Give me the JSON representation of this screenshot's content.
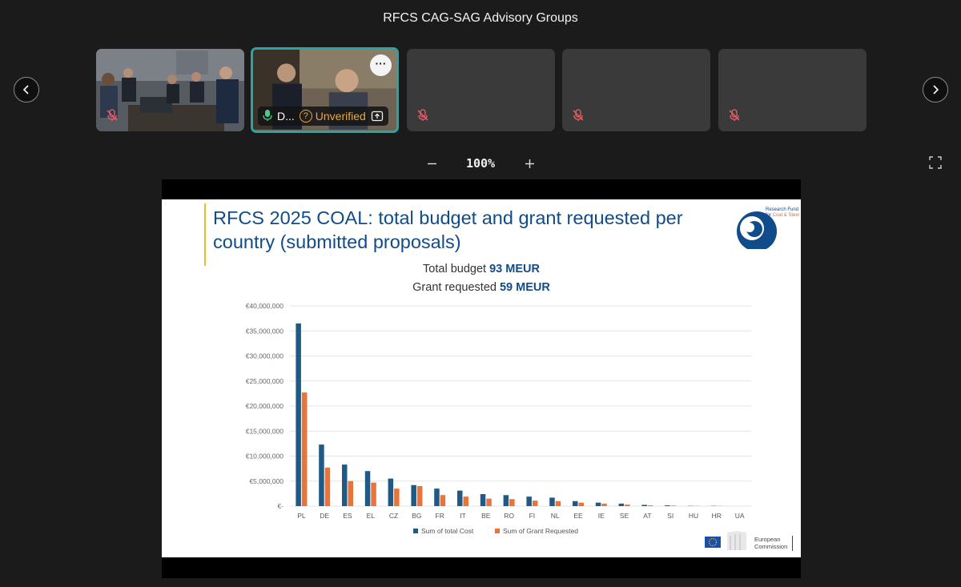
{
  "window": {
    "title": "RFCS CAG-SAG Advisory Groups"
  },
  "participants": [
    {
      "id": "tile-1",
      "name": "",
      "muted": true
    },
    {
      "id": "tile-2",
      "name": "D...",
      "status": "Unverified",
      "active": true,
      "more_label": "···"
    },
    {
      "id": "tile-3",
      "name": "",
      "muted": true
    },
    {
      "id": "tile-4",
      "name": "",
      "muted": true
    },
    {
      "id": "tile-5",
      "name": "",
      "muted": true
    }
  ],
  "zoom": {
    "level": "100%"
  },
  "slide": {
    "title": "RFCS 2025 COAL: total budget and grant requested per country (submitted proposals)",
    "logo_text_1": "Research Fund",
    "logo_text_2a": "for ",
    "logo_text_2b": "Coal & Steel",
    "subtitle1_prefix": "Total budget ",
    "subtitle1_value": "93 MEUR",
    "subtitle2_prefix": "Grant requested ",
    "subtitle2_value": "59 MEUR",
    "ec_line1": "European",
    "ec_line2": "Commission"
  },
  "colors": {
    "series_total": "#1f5a86",
    "series_grant": "#e8743b",
    "active_tile_border": "#2aa5a6",
    "title_blue": "#114c8a"
  },
  "chart_data": {
    "type": "bar",
    "categories": [
      "PL",
      "DE",
      "ES",
      "EL",
      "CZ",
      "BG",
      "FR",
      "IT",
      "BE",
      "RO",
      "FI",
      "NL",
      "EE",
      "IE",
      "SE",
      "AT",
      "SI",
      "HU",
      "HR",
      "UA"
    ],
    "series": [
      {
        "name": "Sum of total Cost",
        "values": [
          36500000,
          12300000,
          8300000,
          7000000,
          5500000,
          4200000,
          3500000,
          3100000,
          2400000,
          2200000,
          1900000,
          1700000,
          1000000,
          700000,
          500000,
          250000,
          150000,
          50000,
          50000,
          0
        ]
      },
      {
        "name": "Sum of Grant Requested",
        "values": [
          22700000,
          7700000,
          5000000,
          4700000,
          3500000,
          4000000,
          2200000,
          1900000,
          1500000,
          1400000,
          1100000,
          1000000,
          700000,
          500000,
          300000,
          150000,
          100000,
          30000,
          30000,
          0
        ]
      }
    ],
    "ylim": [
      0,
      40000000
    ],
    "yticks": [
      "€-",
      "€5,000,000",
      "€10,000,000",
      "€15,000,000",
      "€20,000,000",
      "€25,000,000",
      "€30,000,000",
      "€35,000,000",
      "€40,000,000"
    ],
    "ytick_values": [
      0,
      5000000,
      10000000,
      15000000,
      20000000,
      25000000,
      30000000,
      35000000,
      40000000
    ],
    "grid": true,
    "legend": "bottom"
  }
}
